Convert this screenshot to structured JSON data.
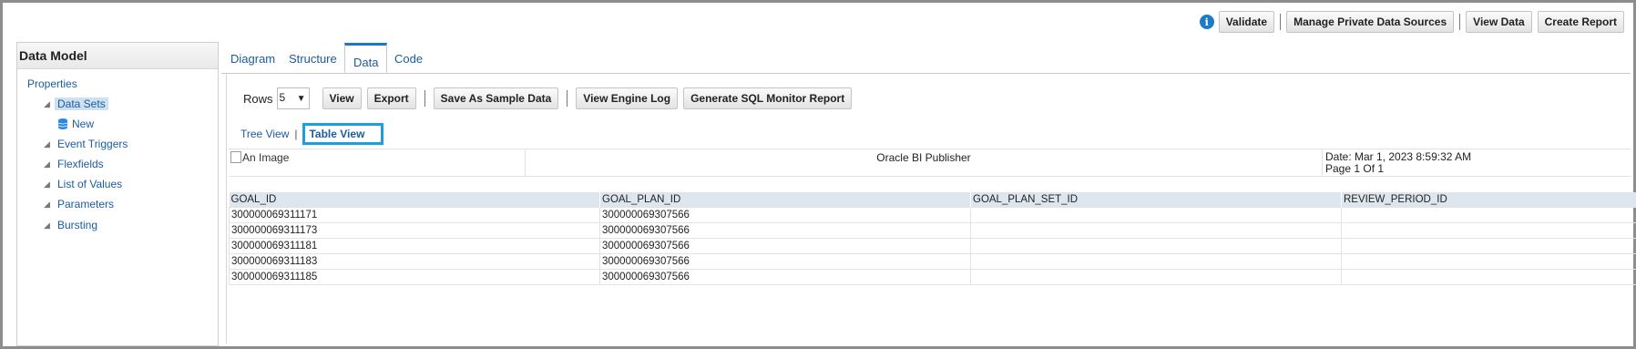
{
  "topbar": {
    "buttons": [
      "Validate",
      "Manage Private Data Sources",
      "View Data",
      "Create Report"
    ]
  },
  "leftpanel": {
    "title": "Data Model",
    "properties": "Properties",
    "data_sets": "Data Sets",
    "new": "New",
    "event_triggers": "Event Triggers",
    "flexfields": "Flexfields",
    "list_of_values": "List of Values",
    "parameters": "Parameters",
    "bursting": "Bursting"
  },
  "tabs": [
    "Diagram",
    "Structure",
    "Data",
    "Code"
  ],
  "toolbar": {
    "rows_label": "Rows",
    "rows_value": "5",
    "view": "View",
    "export": "Export",
    "save_sample": "Save As Sample Data",
    "engine_log": "View Engine Log",
    "sql_monitor": "Generate SQL Monitor Report"
  },
  "views": {
    "tree": "Tree View",
    "table": "Table View"
  },
  "report": {
    "image_alt": "An Image",
    "title": "Oracle BI Publisher",
    "date": "Date: Mar 1, 2023 8:59:32 AM",
    "page": "Page 1 Of 1"
  },
  "table": {
    "columns": [
      "GOAL_ID",
      "GOAL_PLAN_ID",
      "GOAL_PLAN_SET_ID",
      "REVIEW_PERIOD_ID"
    ],
    "rows": [
      [
        "300000069311171",
        "300000069307566",
        "",
        ""
      ],
      [
        "300000069311173",
        "300000069307566",
        "",
        ""
      ],
      [
        "300000069311181",
        "300000069307566",
        "",
        ""
      ],
      [
        "300000069311183",
        "300000069307566",
        "",
        ""
      ],
      [
        "300000069311185",
        "300000069307566",
        "",
        ""
      ]
    ]
  },
  "colors": {
    "accent": "#1b76c9",
    "highlight_box": "#1a9fe0",
    "link": "#1a5c9e"
  }
}
